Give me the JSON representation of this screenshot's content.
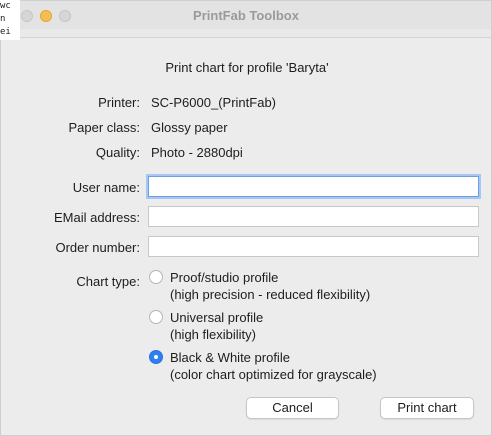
{
  "window": {
    "title": "PrintFab Toolbox"
  },
  "background_text": [
    "wc",
    "n",
    "ei"
  ],
  "dialog": {
    "heading": "Print chart for profile 'Baryta'",
    "info": [
      {
        "label": "Printer:",
        "value": "SC-P6000_(PrintFab)"
      },
      {
        "label": "Paper class:",
        "value": "Glossy paper"
      },
      {
        "label": "Quality:",
        "value": "Photo - 2880dpi"
      }
    ],
    "fields": {
      "user_name": {
        "label": "User name:",
        "value": ""
      },
      "email": {
        "label": "EMail address:",
        "value": ""
      },
      "order_number": {
        "label": "Order number:",
        "value": ""
      }
    },
    "chart_type": {
      "label": "Chart type:",
      "selected": "Black & White profile",
      "options": [
        {
          "title": "Proof/studio profile",
          "desc": "(high precision - reduced flexibility)"
        },
        {
          "title": "Universal profile",
          "desc": "(high flexibility)"
        },
        {
          "title": "Black & White profile",
          "desc": "(color chart optimized for grayscale)"
        }
      ]
    },
    "buttons": {
      "cancel": "Cancel",
      "print": "Print chart"
    }
  },
  "colors": {
    "accent": "#2f7ff2",
    "focus_ring": "#a8c8f3",
    "minimize": "#f5bf4f"
  }
}
